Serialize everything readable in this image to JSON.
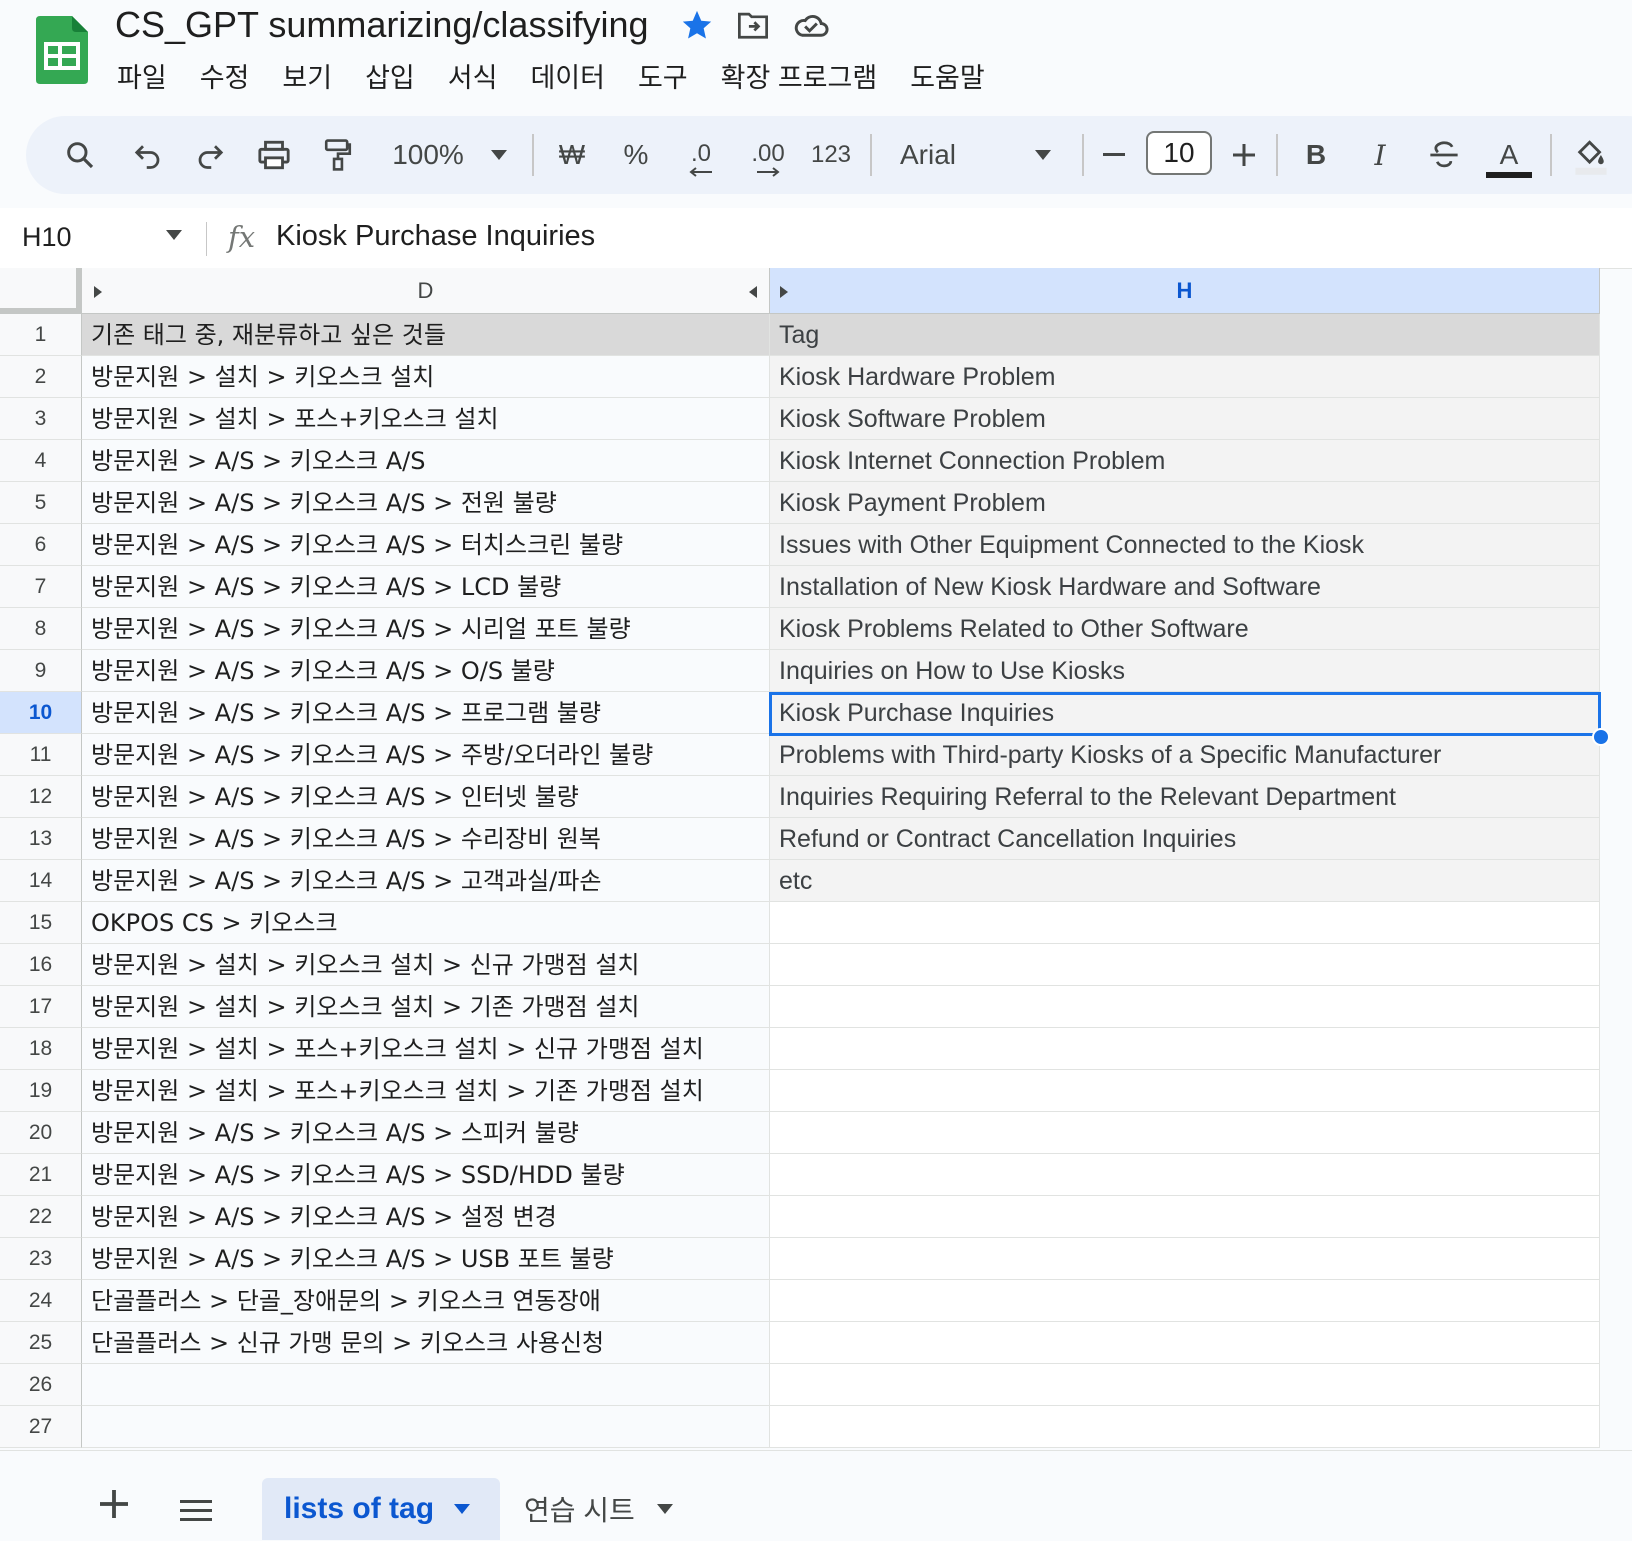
{
  "title": {
    "doc_name": "CS_GPT summarizing/classifying"
  },
  "menu": [
    "파일",
    "수정",
    "보기",
    "삽입",
    "서식",
    "데이터",
    "도구",
    "확장 프로그램",
    "도움말"
  ],
  "toolbar": {
    "zoom": "100%",
    "currency": "₩",
    "percent": "%",
    "decimal_decrease": ".0",
    "decimal_increase": ".00",
    "number_format": "123",
    "font": "Arial",
    "font_size": "10",
    "bold": "B",
    "italic": "I",
    "text_color_letter": "A"
  },
  "formula_bar": {
    "cell_ref": "H10",
    "fx": "fx",
    "value": "Kiosk Purchase Inquiries"
  },
  "columns": {
    "d": "D",
    "h": "H"
  },
  "rows": [
    {
      "n": "1",
      "d": "기존 태그 중, 재분류하고 싶은 것들",
      "h": "Tag"
    },
    {
      "n": "2",
      "d": "방문지원 > 설치 > 키오스크 설치",
      "h": "Kiosk Hardware Problem"
    },
    {
      "n": "3",
      "d": "방문지원 > 설치 > 포스+키오스크 설치",
      "h": "Kiosk Software Problem"
    },
    {
      "n": "4",
      "d": "방문지원 > A/S > 키오스크 A/S",
      "h": "Kiosk Internet Connection Problem"
    },
    {
      "n": "5",
      "d": "방문지원 > A/S > 키오스크 A/S > 전원 불량",
      "h": "Kiosk Payment Problem"
    },
    {
      "n": "6",
      "d": "방문지원 > A/S > 키오스크 A/S > 터치스크린 불량",
      "h": "Issues with Other Equipment Connected to the Kiosk"
    },
    {
      "n": "7",
      "d": "방문지원 > A/S > 키오스크 A/S > LCD 불량",
      "h": "Installation of New Kiosk Hardware and Software"
    },
    {
      "n": "8",
      "d": "방문지원 > A/S > 키오스크 A/S > 시리얼 포트 불량",
      "h": "Kiosk Problems Related to Other Software"
    },
    {
      "n": "9",
      "d": "방문지원 > A/S > 키오스크 A/S > O/S 불량",
      "h": "Inquiries on How to Use Kiosks"
    },
    {
      "n": "10",
      "d": "방문지원 > A/S > 키오스크 A/S > 프로그램 불량",
      "h": "Kiosk Purchase Inquiries"
    },
    {
      "n": "11",
      "d": "방문지원 > A/S > 키오스크 A/S > 주방/오더라인 불량",
      "h": "Problems with Third-party Kiosks of a Specific Manufacturer"
    },
    {
      "n": "12",
      "d": "방문지원 > A/S > 키오스크 A/S > 인터넷 불량",
      "h": "Inquiries Requiring Referral to the Relevant Department"
    },
    {
      "n": "13",
      "d": "방문지원 > A/S > 키오스크 A/S > 수리장비 원복",
      "h": "Refund or Contract Cancellation Inquiries"
    },
    {
      "n": "14",
      "d": "방문지원 > A/S > 키오스크 A/S > 고객과실/파손",
      "h": "etc"
    },
    {
      "n": "15",
      "d": "OKPOS CS > 키오스크",
      "h": ""
    },
    {
      "n": "16",
      "d": "방문지원 > 설치 > 키오스크 설치 > 신규 가맹점 설치",
      "h": ""
    },
    {
      "n": "17",
      "d": "방문지원 > 설치 > 키오스크 설치 > 기존 가맹점 설치",
      "h": ""
    },
    {
      "n": "18",
      "d": "방문지원 > 설치 > 포스+키오스크 설치 > 신규 가맹점 설치",
      "h": ""
    },
    {
      "n": "19",
      "d": "방문지원 > 설치 > 포스+키오스크 설치 > 기존 가맹점 설치",
      "h": ""
    },
    {
      "n": "20",
      "d": "방문지원 > A/S > 키오스크 A/S > 스피커 불량",
      "h": ""
    },
    {
      "n": "21",
      "d": "방문지원 > A/S > 키오스크 A/S > SSD/HDD 불량",
      "h": ""
    },
    {
      "n": "22",
      "d": "방문지원 > A/S > 키오스크 A/S > 설정 변경",
      "h": ""
    },
    {
      "n": "23",
      "d": "방문지원 > A/S > 키오스크 A/S > USB 포트 불량",
      "h": ""
    },
    {
      "n": "24",
      "d": "단골플러스 > 단골_장애문의 > 키오스크 연동장애",
      "h": ""
    },
    {
      "n": "25",
      "d": "단골플러스 > 신규 가맹 문의 > 키오스크 사용신청",
      "h": ""
    },
    {
      "n": "26",
      "d": "",
      "h": ""
    },
    {
      "n": "27",
      "d": "",
      "h": ""
    }
  ],
  "sheet_tabs": {
    "active": "lists of tag",
    "other": "연습 시트"
  },
  "colors": {
    "accent": "#0b57d0",
    "selection": "#1a73e8",
    "header_selected": "#d3e3fd"
  }
}
